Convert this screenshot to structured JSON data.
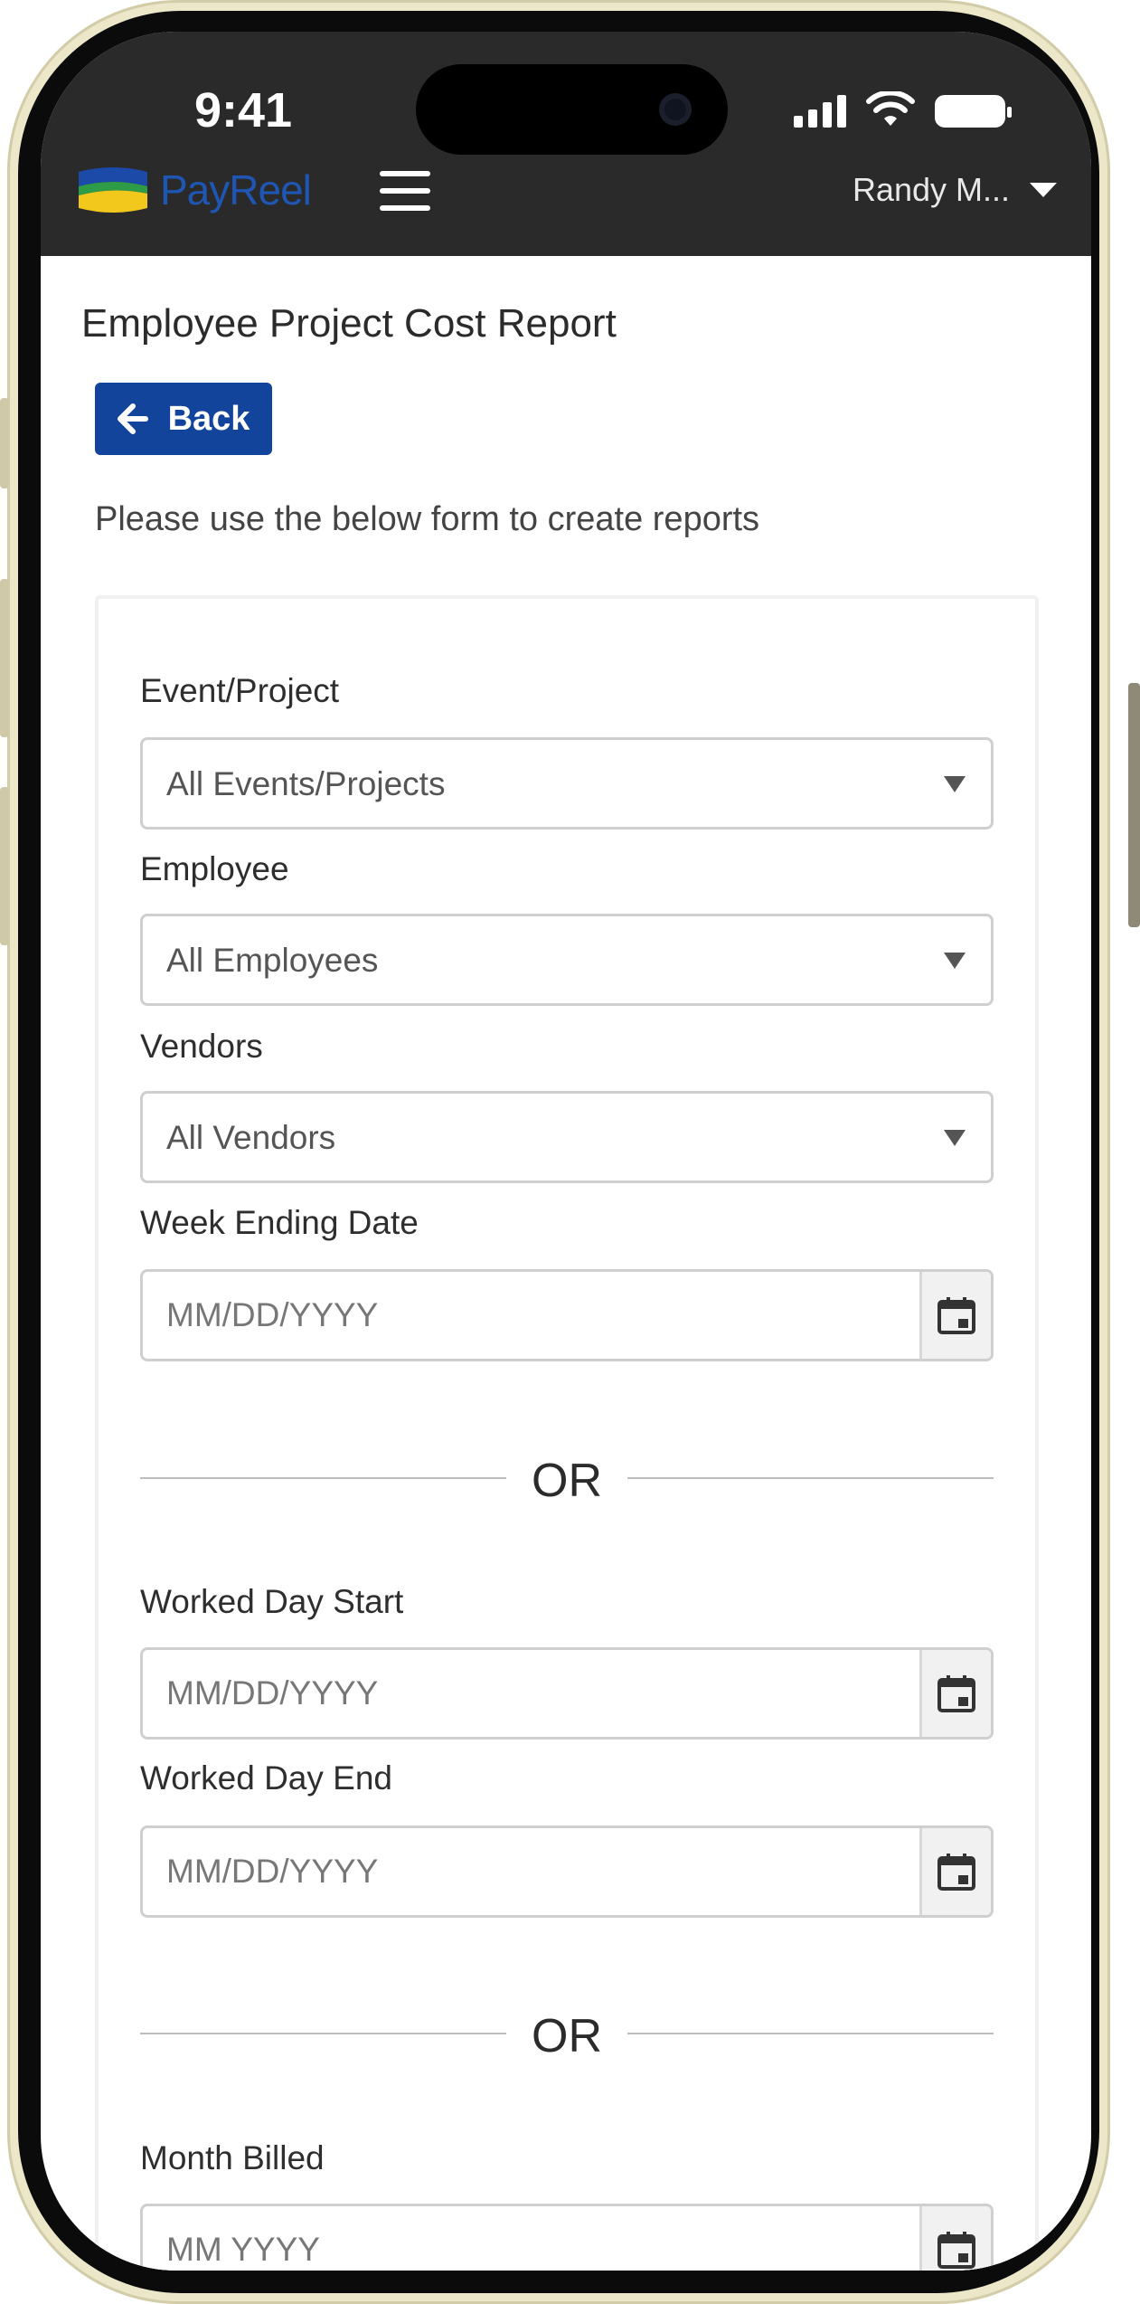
{
  "status_bar": {
    "time": "9:41"
  },
  "header": {
    "brand_pay": "Pay",
    "brand_reel": "Reel",
    "user_name": "Randy M..."
  },
  "page": {
    "title": "Employee Project Cost Report",
    "back_label": "Back",
    "intro": "Please use the below form to create reports"
  },
  "form": {
    "event_project": {
      "label": "Event/Project",
      "value": "All Events/Projects"
    },
    "employee": {
      "label": "Employee",
      "value": "All Employees"
    },
    "vendors": {
      "label": "Vendors",
      "value": "All Vendors"
    },
    "week_ending": {
      "label": "Week Ending Date",
      "placeholder": "MM/DD/YYYY"
    },
    "or_1": "OR",
    "worked_day_start": {
      "label": "Worked Day Start",
      "placeholder": "MM/DD/YYYY"
    },
    "worked_day_end": {
      "label": "Worked Day End",
      "placeholder": "MM/DD/YYYY"
    },
    "or_2": "OR",
    "month_billed": {
      "label": "Month Billed",
      "placeholder": "MM YYYY"
    }
  },
  "colors": {
    "header_bg": "#2a2a2a",
    "brand_blue": "#1f56b3",
    "back_button": "#13449c",
    "logo_green": "#2e9b46",
    "logo_yellow": "#f2c81c"
  },
  "icons": [
    "signal-icon",
    "wifi-icon",
    "battery-icon",
    "menu-icon",
    "caret-down-icon",
    "arrow-left-icon",
    "calendar-icon"
  ]
}
